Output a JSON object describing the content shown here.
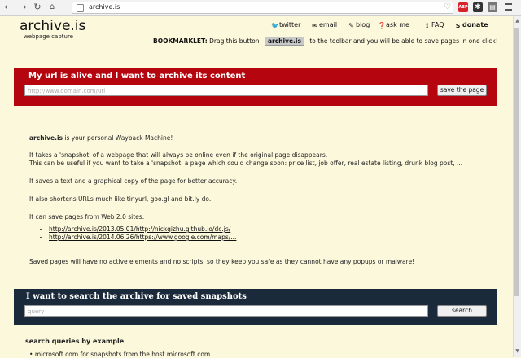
{
  "browser": {
    "back": "←",
    "forward": "→",
    "reload": "↻",
    "url": "archive.is",
    "ext_abp": "ABP"
  },
  "header": {
    "logo": "archive.is",
    "tagline": "webpage capture",
    "links": [
      {
        "icon": "twitter-icon",
        "glyph": "🐦",
        "label": "twitter"
      },
      {
        "icon": "email-icon",
        "glyph": "✉",
        "label": "email"
      },
      {
        "icon": "blog-icon",
        "glyph": "✎",
        "label": "blog"
      },
      {
        "icon": "ask-icon",
        "glyph": "❓",
        "label": "ask me"
      },
      {
        "icon": "faq-icon",
        "glyph": "ℹ",
        "label": "FAQ"
      },
      {
        "icon": "donate-icon",
        "glyph": "$",
        "label": "donate"
      }
    ],
    "bookmarklet_label": "BOOKMARKLET:",
    "bookmarklet_pre": "Drag this button",
    "bookmarklet_button": "archive.is",
    "bookmarklet_post": "to the toolbar and you will be able to save pages in one click!"
  },
  "archive_box": {
    "title": "My url is alive and I want to archive its content",
    "placeholder": "http://www.domain.com/url",
    "button": "save the page"
  },
  "content": {
    "intro_bold": "archive.is",
    "intro_rest": " is your personal Wayback Machine!",
    "p1a": "It takes a 'snapshot' of a webpage that will always be online even if the original page disappears.",
    "p1b": "This can be useful if you want to take a 'snapshot' a page which could change soon: price list, job offer, real estate listing, drunk blog post, ...",
    "p2": "It saves a text and a graphical copy of the page for better accuracy.",
    "p3": "It also shortens URLs much like tinyurl, goo.gl and bit.ly do.",
    "p4": "It can save pages from Web 2.0 sites:",
    "examples": [
      "http://archive.is/2013.05.01/http://nickqizhu.github.io/dc.js/",
      "http://archive.is/2014.06.26/https://www.google.com/maps/..."
    ],
    "p5": "Saved pages will have no active elements and no scripts, so they keep you safe as they cannot have any popups or malware!"
  },
  "search_box": {
    "title": "I want to search the archive for saved snapshots",
    "placeholder": "query",
    "button": "search"
  },
  "search_queries": {
    "title": "search queries by example",
    "item": "microsoft.com    for snapshots from the host microsoft.com"
  }
}
